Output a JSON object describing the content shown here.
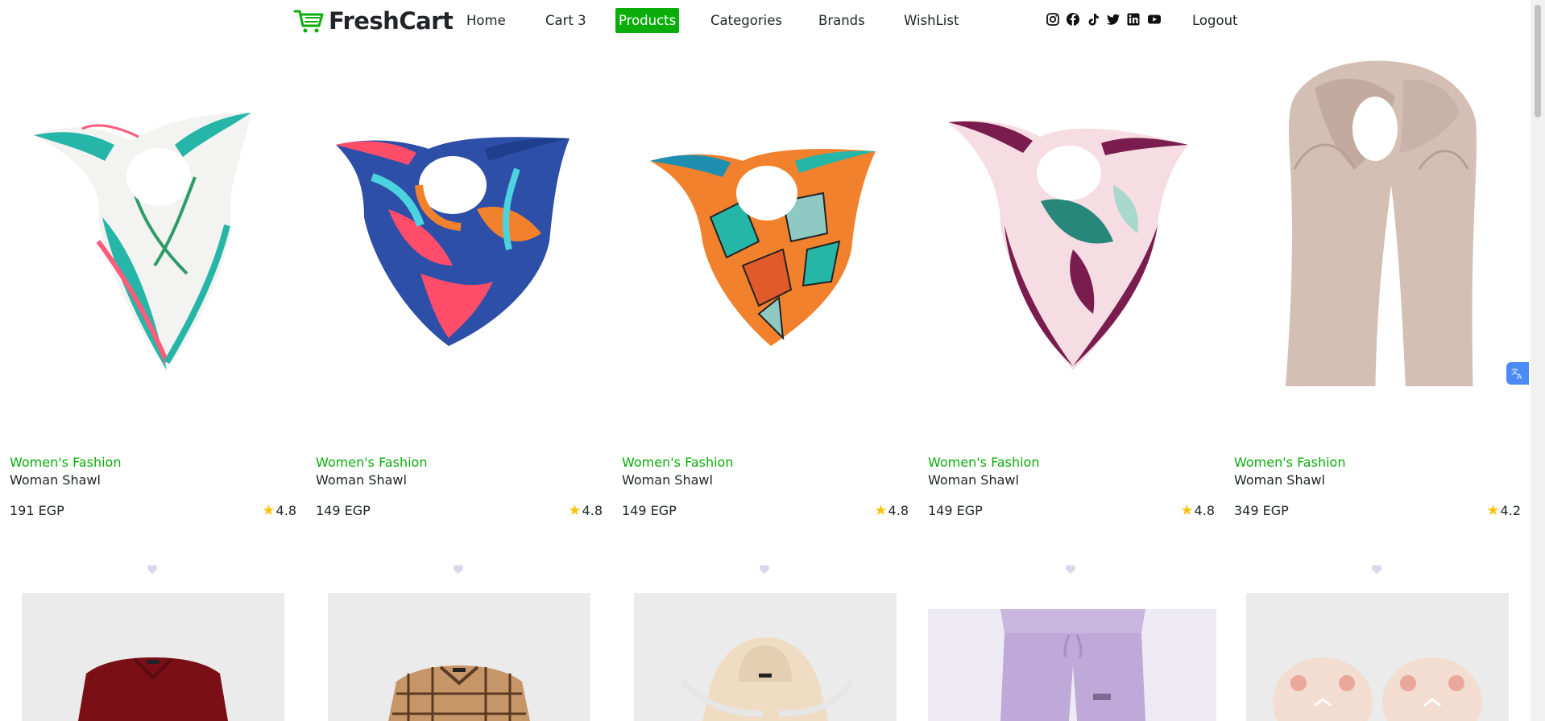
{
  "brand": {
    "name": "FreshCart",
    "accent": "#0aad0a"
  },
  "nav": {
    "home": "Home",
    "cart": "Cart 3",
    "products": "Products",
    "categories": "Categories",
    "brands": "Brands",
    "wishlist": "WishList",
    "logout": "Logout"
  },
  "social_icons": [
    "instagram-icon",
    "facebook-icon",
    "tiktok-icon",
    "twitter-icon",
    "linkedin-icon",
    "youtube-icon"
  ],
  "products": [
    {
      "category": "Women's Fashion",
      "title": "Woman Shawl",
      "price": "191 EGP",
      "rating": "4.8"
    },
    {
      "category": "Women's Fashion",
      "title": "Woman Shawl",
      "price": "149 EGP",
      "rating": "4.8"
    },
    {
      "category": "Women's Fashion",
      "title": "Woman Shawl",
      "price": "149 EGP",
      "rating": "4.8"
    },
    {
      "category": "Women's Fashion",
      "title": "Woman Shawl",
      "price": "149 EGP",
      "rating": "4.8"
    },
    {
      "category": "Women's Fashion",
      "title": "Woman Shawl",
      "price": "349 EGP",
      "rating": "4.2"
    }
  ],
  "colors": {
    "star": "#ffc107",
    "category_text": "#0aad0a"
  }
}
